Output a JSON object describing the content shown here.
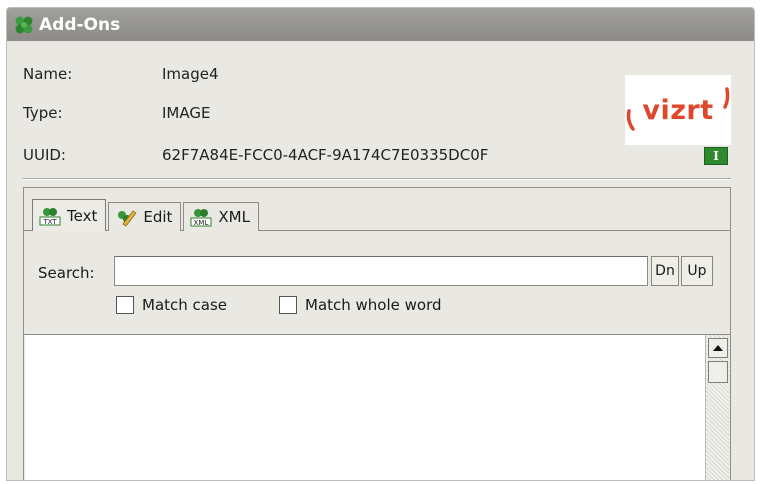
{
  "window": {
    "title": "Add-Ons"
  },
  "info": {
    "name_label": "Name:",
    "name_value": "Image4",
    "type_label": "Type:",
    "type_value": "IMAGE",
    "uuid_label": "UUID:",
    "uuid_value": "62F7A84E-FCC0-4ACF-9A174C7E0335DC0F"
  },
  "logo": {
    "text": "vizrt",
    "color": "#e0462b"
  },
  "info_badge": {
    "icon": "info-icon",
    "glyph": "I",
    "color": "#2d8b2d"
  },
  "tabs": [
    {
      "label": "Text",
      "icon": "text-plugin-icon",
      "active": true
    },
    {
      "label": "Edit",
      "icon": "edit-plugin-icon",
      "active": false
    },
    {
      "label": "XML",
      "icon": "xml-plugin-icon",
      "active": false
    }
  ],
  "search": {
    "label": "Search:",
    "value": "",
    "placeholder": "",
    "down_label": "Dn",
    "up_label": "Up"
  },
  "options": {
    "match_case": {
      "label": "Match case",
      "checked": false
    },
    "match_whole_word": {
      "label": "Match whole word",
      "checked": false
    }
  },
  "colors": {
    "titlebar": "#8c8b88",
    "panel": "#e9e8e3",
    "accent_green": "#2d8b2d"
  }
}
